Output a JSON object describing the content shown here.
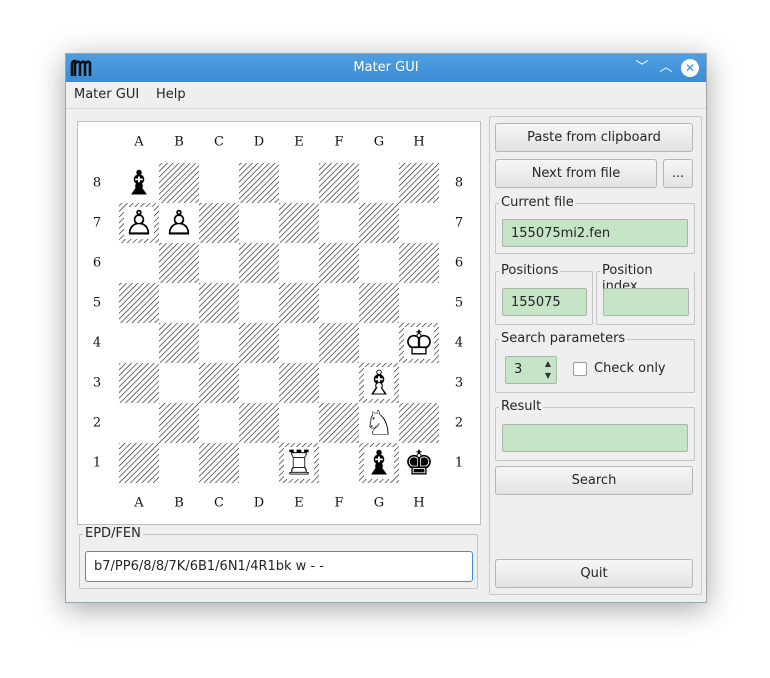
{
  "window": {
    "title": "Mater GUI",
    "logo_text": "𝔪"
  },
  "menu": {
    "items": [
      "Mater GUI",
      "Help"
    ]
  },
  "board": {
    "files": [
      "A",
      "B",
      "C",
      "D",
      "E",
      "F",
      "G",
      "H"
    ],
    "ranks": [
      "8",
      "7",
      "6",
      "5",
      "4",
      "3",
      "2",
      "1"
    ],
    "pieces": [
      {
        "square": "a8",
        "glyph": "♝",
        "color": "black",
        "name": "black-bishop-a8"
      },
      {
        "square": "a7",
        "glyph": "♙",
        "color": "white",
        "name": "white-pawn-a7"
      },
      {
        "square": "b7",
        "glyph": "♙",
        "color": "white",
        "name": "white-pawn-b7"
      },
      {
        "square": "h4",
        "glyph": "♔",
        "color": "white",
        "name": "white-king-h4"
      },
      {
        "square": "g3",
        "glyph": "♗",
        "color": "white",
        "name": "white-bishop-g3"
      },
      {
        "square": "g2",
        "glyph": "♘",
        "color": "white",
        "name": "white-knight-g2"
      },
      {
        "square": "e1",
        "glyph": "♖",
        "color": "white",
        "name": "white-rook-e1"
      },
      {
        "square": "g1",
        "glyph": "♝",
        "color": "black",
        "name": "black-bishop-g1"
      },
      {
        "square": "h1",
        "glyph": "♚",
        "color": "black",
        "name": "black-king-h1"
      }
    ]
  },
  "fen": {
    "label": "EPD/FEN",
    "value": "b7/PP6/8/8/7K/6B1/6N1/4R1bk w - -"
  },
  "controls": {
    "paste_label": "Paste from clipboard",
    "next_label": "Next from file",
    "browse_label": "...",
    "current_file_label": "Current file",
    "current_file_value": "155075mi2.fen",
    "positions_label": "Positions",
    "positions_value": "155075",
    "position_index_label": "Position index",
    "position_index_value": "",
    "search_params_label": "Search parameters",
    "depth_value": "3",
    "check_only_label": "Check only",
    "result_label": "Result",
    "result_value": "",
    "search_label": "Search",
    "quit_label": "Quit"
  }
}
